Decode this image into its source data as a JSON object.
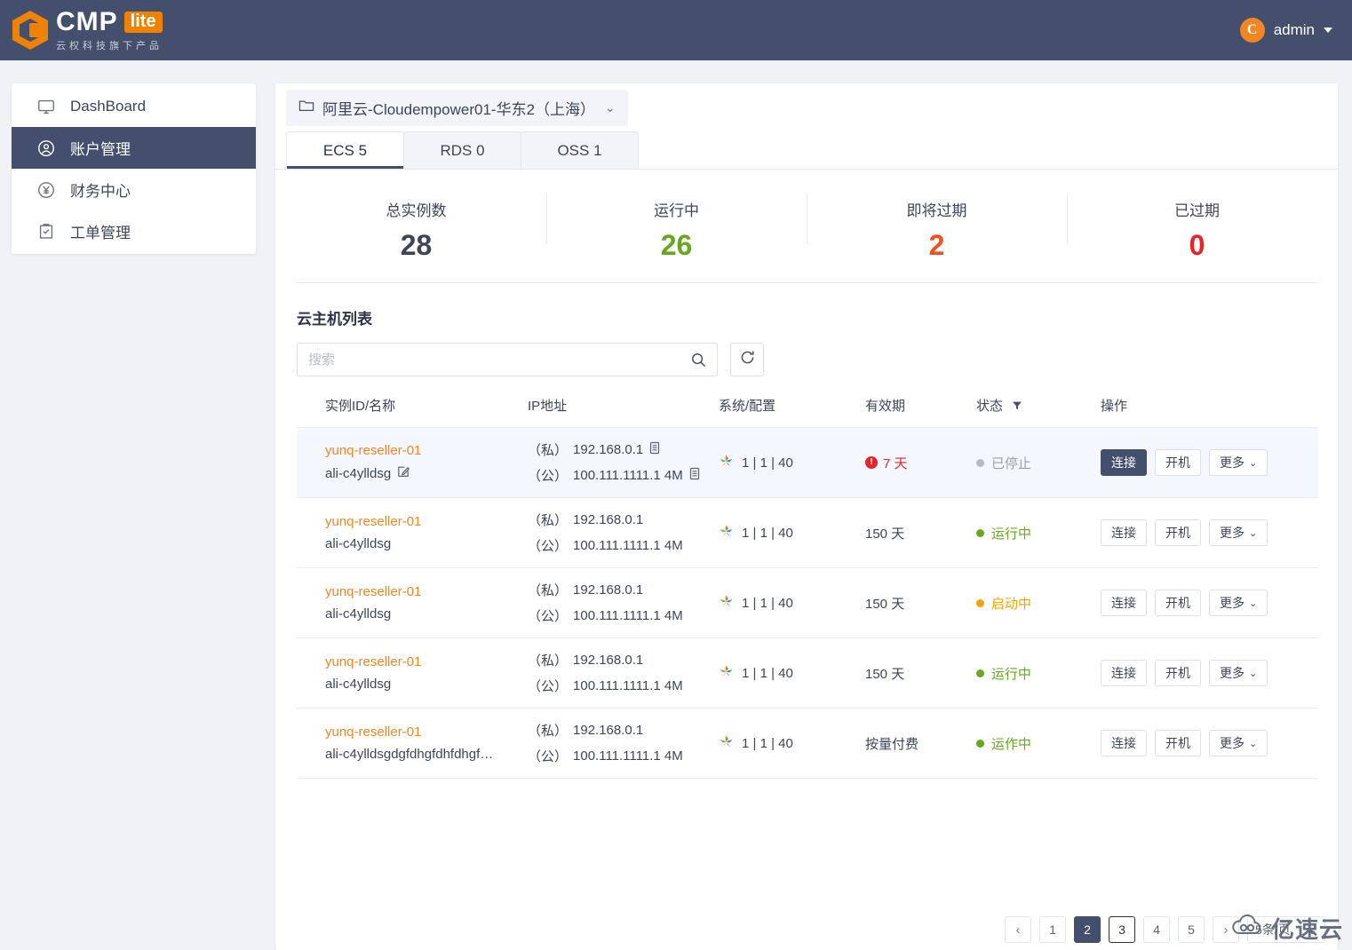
{
  "topbar": {
    "logo_name": "CMP",
    "logo_badge": "lite",
    "logo_sub": "云权科技旗下产品",
    "logo_icon": "cmp-hex-logo-icon",
    "user_initial": "C",
    "user_name": "admin",
    "caret_icon": "caret-down-icon"
  },
  "sidebar": {
    "items": [
      {
        "label": "DashBoard",
        "icon": "monitor-icon",
        "active": false
      },
      {
        "label": "账户管理",
        "icon": "user-circle-icon",
        "active": true
      },
      {
        "label": "财务中心",
        "icon": "yen-circle-icon",
        "active": false
      },
      {
        "label": "工单管理",
        "icon": "clipboard-check-icon",
        "active": false
      }
    ]
  },
  "breadcrumb": {
    "folder_icon": "folder-icon",
    "label": "阿里云-Cloudempower01-华东2（上海）",
    "chevron_icon": "chevron-down-icon",
    "chevron": "⌄"
  },
  "tabs": [
    {
      "label": "ECS 5",
      "active": true
    },
    {
      "label": "RDS 0",
      "active": false
    },
    {
      "label": "OSS 1",
      "active": false
    }
  ],
  "stats": [
    {
      "label": "总实例数",
      "value": "28",
      "color": "#3d4557"
    },
    {
      "label": "运行中",
      "value": "26",
      "color": "#67a81f"
    },
    {
      "label": "即将过期",
      "value": "2",
      "color": "#f4511e"
    },
    {
      "label": "已过期",
      "value": "0",
      "color": "#e8232a"
    }
  ],
  "list": {
    "title": "云主机列表",
    "search_placeholder": "搜索",
    "search_value": "",
    "search_icon": "search-icon",
    "refresh_icon": "refresh-icon",
    "columns": {
      "id": "实例ID/名称",
      "ip": "IP地址",
      "sys": "系统/配置",
      "exp": "有效期",
      "state": "状态",
      "state_filter_icon": "filter-icon",
      "actions": "操作"
    },
    "rows": [
      {
        "instance_id": "yunq-reseller-01",
        "name": "ali-c4ylldsg",
        "name_edit_icon": "edit-icon",
        "has_edit": true,
        "ip_private_tag": "（私）",
        "ip_private": "192.168.0.1",
        "ip_public_tag": "（公）",
        "ip_public": "100.111.1111.1 4M",
        "has_copy": true,
        "copy_icon": "copy-icon",
        "os_icon": "windows-icon",
        "config": "1 | 1 | 40",
        "expiry": "7 天",
        "expiry_color": "#e8232a",
        "expiry_warning": true,
        "warning_glyph": "!",
        "state": "已停止",
        "state_color": "#9aa0ae",
        "state_dot": "#b6bac4",
        "highlighted": true,
        "buttons": [
          {
            "label": "连接",
            "primary": true
          },
          {
            "label": "开机",
            "primary": false
          },
          {
            "label": "更多",
            "primary": false,
            "chevron": "⌄"
          }
        ]
      },
      {
        "instance_id": "yunq-reseller-01",
        "name": "ali-c4ylldsg",
        "name_edit_icon": "edit-icon",
        "has_edit": false,
        "ip_private_tag": "（私）",
        "ip_private": "192.168.0.1",
        "ip_public_tag": "（公）",
        "ip_public": "100.111.1111.1 4M",
        "has_copy": false,
        "copy_icon": "copy-icon",
        "os_icon": "windows-icon",
        "config": "1 | 1 | 40",
        "expiry": "150 天",
        "expiry_color": "#3d4557",
        "expiry_warning": false,
        "warning_glyph": "!",
        "state": "运行中",
        "state_color": "#67a81f",
        "state_dot": "#67a81f",
        "highlighted": false,
        "buttons": [
          {
            "label": "连接",
            "primary": false
          },
          {
            "label": "开机",
            "primary": false
          },
          {
            "label": "更多",
            "primary": false,
            "chevron": "⌄"
          }
        ]
      },
      {
        "instance_id": "yunq-reseller-01",
        "name": "ali-c4ylldsg",
        "name_edit_icon": "edit-icon",
        "has_edit": false,
        "ip_private_tag": "（私）",
        "ip_private": "192.168.0.1",
        "ip_public_tag": "（公）",
        "ip_public": "100.111.1111.1 4M",
        "has_copy": false,
        "copy_icon": "copy-icon",
        "os_icon": "windows-icon",
        "config": "1 | 1 | 40",
        "expiry": "150 天",
        "expiry_color": "#3d4557",
        "expiry_warning": false,
        "warning_glyph": "!",
        "state": "启动中",
        "state_color": "#f5a300",
        "state_dot": "#f5a300",
        "highlighted": false,
        "buttons": [
          {
            "label": "连接",
            "primary": false
          },
          {
            "label": "开机",
            "primary": false
          },
          {
            "label": "更多",
            "primary": false,
            "chevron": "⌄"
          }
        ]
      },
      {
        "instance_id": "yunq-reseller-01",
        "name": "ali-c4ylldsg",
        "name_edit_icon": "edit-icon",
        "has_edit": false,
        "ip_private_tag": "（私）",
        "ip_private": "192.168.0.1",
        "ip_public_tag": "（公）",
        "ip_public": "100.111.1111.1 4M",
        "has_copy": false,
        "copy_icon": "copy-icon",
        "os_icon": "windows-icon",
        "config": "1 | 1 | 40",
        "expiry": "150 天",
        "expiry_color": "#3d4557",
        "expiry_warning": false,
        "warning_glyph": "!",
        "state": "运行中",
        "state_color": "#67a81f",
        "state_dot": "#67a81f",
        "highlighted": false,
        "buttons": [
          {
            "label": "连接",
            "primary": false
          },
          {
            "label": "开机",
            "primary": false
          },
          {
            "label": "更多",
            "primary": false,
            "chevron": "⌄"
          }
        ]
      },
      {
        "instance_id": "yunq-reseller-01",
        "name": "ali-c4ylldsgdgfdhgfdhfdhgf…",
        "name_edit_icon": "edit-icon",
        "has_edit": false,
        "ip_private_tag": "（私）",
        "ip_private": "192.168.0.1",
        "ip_public_tag": "（公）",
        "ip_public": "100.111.1111.1 4M",
        "has_copy": false,
        "copy_icon": "copy-icon",
        "os_icon": "windows-icon",
        "config": "1 | 1 | 40",
        "expiry": "按量付费",
        "expiry_color": "#3d4557",
        "expiry_warning": false,
        "warning_glyph": "!",
        "state": "运作中",
        "state_color": "#67a81f",
        "state_dot": "#67a81f",
        "highlighted": false,
        "buttons": [
          {
            "label": "连接",
            "primary": false
          },
          {
            "label": "开机",
            "primary": false
          },
          {
            "label": "更多",
            "primary": false,
            "chevron": "⌄"
          }
        ]
      }
    ]
  },
  "pagination": {
    "prev_icon": "chevron-left-icon",
    "prev": "‹",
    "next_icon": "chevron-right-icon",
    "next": "›",
    "pages": [
      "1",
      "2",
      "3",
      "4",
      "5"
    ],
    "current": "2",
    "focused": "3",
    "page_size": "5条/页",
    "page_size_chevron": "⌄"
  },
  "watermark": {
    "text": "亿速云",
    "icon": "cloud-icon"
  }
}
